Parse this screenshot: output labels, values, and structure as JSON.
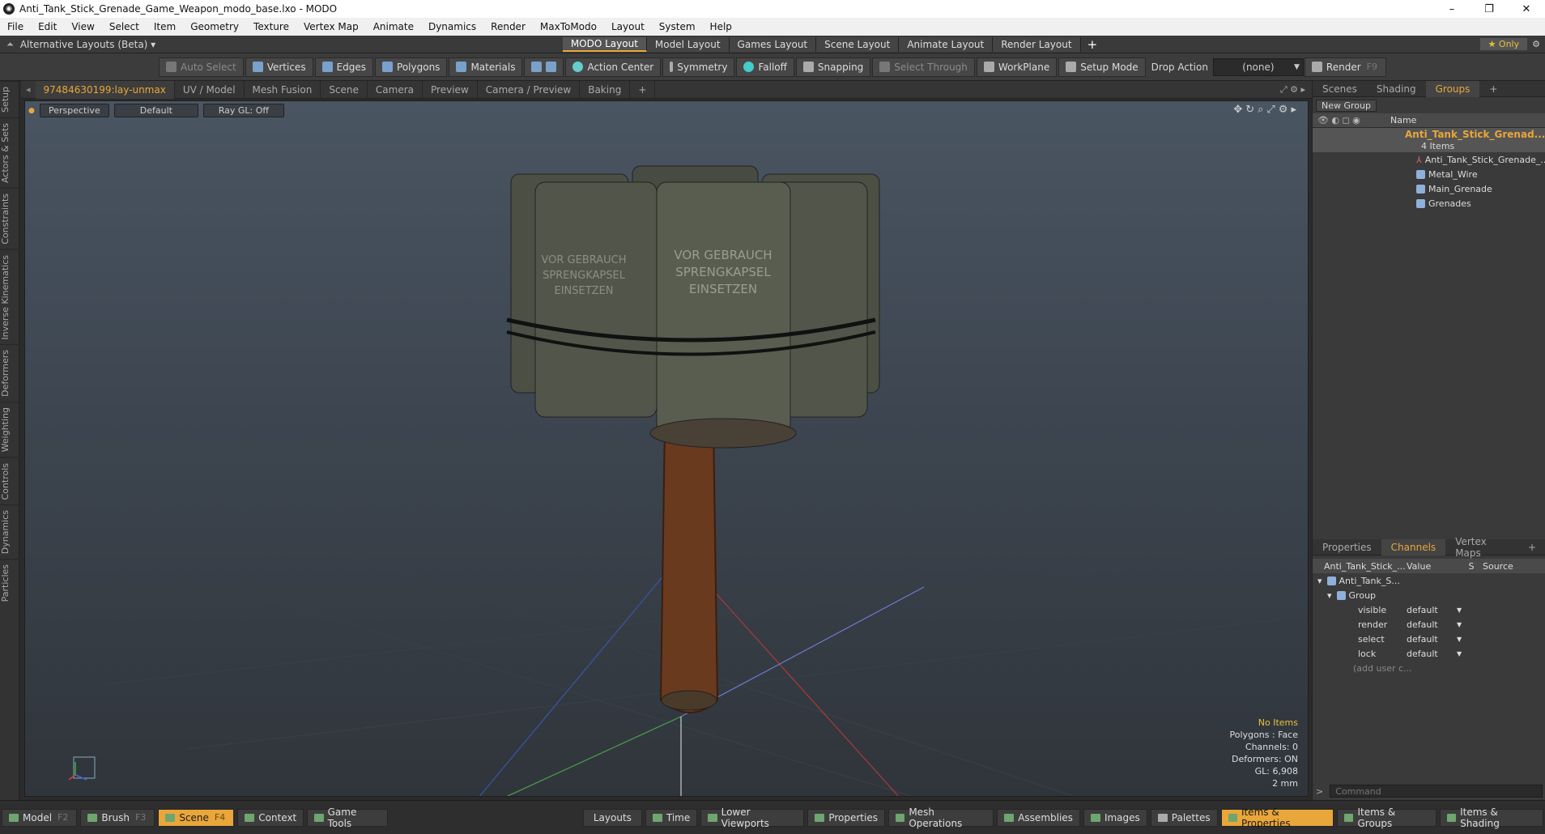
{
  "window": {
    "title": "Anti_Tank_Stick_Grenade_Game_Weapon_modo_base.lxo - MODO",
    "controls": [
      "–",
      "❐",
      "✕"
    ]
  },
  "menu": [
    "File",
    "Edit",
    "View",
    "Select",
    "Item",
    "Geometry",
    "Texture",
    "Vertex Map",
    "Animate",
    "Dynamics",
    "Render",
    "MaxToModo",
    "Layout",
    "System",
    "Help"
  ],
  "layoutbar": {
    "alt_layouts": "Alternative Layouts (Beta) ▾",
    "tabs": [
      "MODO Layout",
      "Model Layout",
      "Games Layout",
      "Scene Layout",
      "Animate Layout",
      "Render Layout"
    ],
    "add": "+",
    "only": "★  Only"
  },
  "toolbar": {
    "auto_select": "Auto Select",
    "vertices": "Vertices",
    "edges": "Edges",
    "polygons": "Polygons",
    "materials": "Materials",
    "action_center": "Action Center",
    "symmetry": "Symmetry",
    "falloff": "Falloff",
    "snapping": "Snapping",
    "select_through": "Select Through",
    "workplane": "WorkPlane",
    "setup_mode": "Setup Mode",
    "drop_action": "Drop Action",
    "drop_value": "(none)",
    "render": "Render",
    "render_key": "F9"
  },
  "left_tabs": [
    "Setup",
    "Actors & Sets",
    "Constraints",
    "Inverse Kinematics",
    "Deformers",
    "Weighting",
    "Controls",
    "Dynamics",
    "Particles"
  ],
  "viewport_tabs": [
    "97484630199:lay-unmax",
    "UV / Model",
    "Mesh Fusion",
    "Scene",
    "Camera",
    "Preview",
    "Camera / Preview",
    "Baking",
    "+"
  ],
  "viewport": {
    "view": "Perspective",
    "shading": "Default",
    "raygl": "Ray GL: Off",
    "text_line1": "VOR GEBRAUCH",
    "text_line2": "SPRENGKAPSEL",
    "text_line3": "EINSETZEN",
    "info": {
      "items": "No Items",
      "polygons": "Polygons : Face",
      "channels": "Channels: 0",
      "deformers": "Deformers: ON",
      "gl": "GL: 6,908",
      "size": "2 mm"
    }
  },
  "groups_panel": {
    "tabs": [
      "Scenes",
      "Shading",
      "Groups",
      "+"
    ],
    "new_group": "New Group",
    "name_header": "Name",
    "root": "Anti_Tank_Stick_Grenad...",
    "root_count": "4 Items",
    "children": [
      "Anti_Tank_Stick_Grenade_...",
      "Metal_Wire",
      "Main_Grenade",
      "Grenades"
    ]
  },
  "channels_panel": {
    "tabs": [
      "Properties",
      "Channels",
      "Vertex Maps",
      "+"
    ],
    "headers": [
      "Anti_Tank_Stick_...",
      "Value",
      "S",
      "Source"
    ],
    "item": "Anti_Tank_S...",
    "group": "Group",
    "rows": [
      {
        "name": "visible",
        "value": "default"
      },
      {
        "name": "render",
        "value": "default"
      },
      {
        "name": "select",
        "value": "default"
      },
      {
        "name": "lock",
        "value": "default"
      }
    ],
    "add_user": "(add user c..."
  },
  "command": {
    "placeholder": "Command"
  },
  "bottom": {
    "left": [
      {
        "label": "Model",
        "key": "F2"
      },
      {
        "label": "Brush",
        "key": "F3"
      },
      {
        "label": "Scene",
        "key": "F4",
        "active": true
      },
      {
        "label": "Context"
      },
      {
        "label": "Game Tools"
      }
    ],
    "center": [
      "Layouts",
      "Time",
      "Lower Viewports",
      "Properties",
      "Mesh Operations",
      "Assemblies",
      "Images"
    ],
    "right": [
      "Palettes",
      "Items & Properties",
      "Items & Groups",
      "Items & Shading"
    ]
  }
}
